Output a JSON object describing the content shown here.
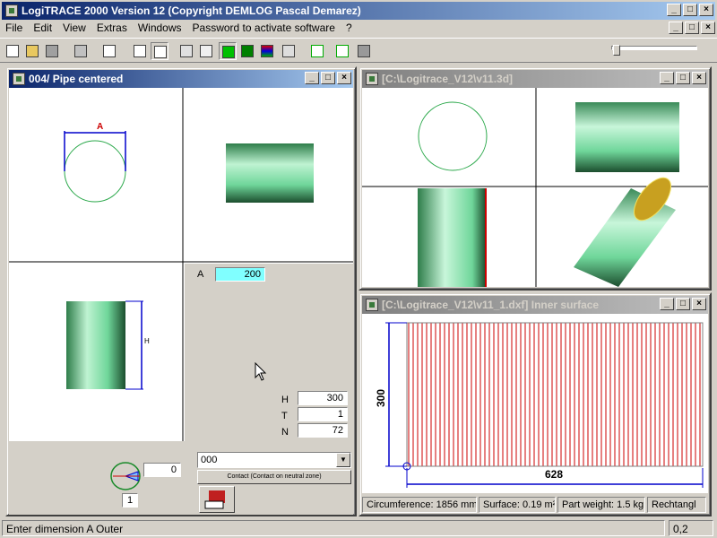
{
  "app": {
    "title": "LogiTRACE 2000  Version 12  (Copyright DEMLOG Pascal Demarez)"
  },
  "menu": [
    "File",
    "Edit",
    "View",
    "Extras",
    "Windows",
    "Password to activate software",
    "?"
  ],
  "win_main": {
    "title": "004/ Pipe centered"
  },
  "win_3d": {
    "title": "[C:\\Logitrace_V12\\v11.3d]"
  },
  "win_dxf": {
    "title": "[C:\\Logitrace_V12\\v11_1.dxf]  Inner surface"
  },
  "dims": {
    "a_label": "A",
    "a_value": "200",
    "h_label": "H",
    "h_value": "300",
    "t_label": "T",
    "t_value": "1",
    "n_label": "N",
    "n_value": "72",
    "drawing_a": "A",
    "drawing_h": "H"
  },
  "contact": {
    "select_value": "000",
    "button_label": "Contact (Contact on neutral zone)"
  },
  "angle": {
    "value": "0",
    "count": "1"
  },
  "dxf": {
    "height_label": "300",
    "width_label": "628",
    "circumference": "Circumference: 1856 mm",
    "surface": "Surface: 0.19 m²",
    "weight": "Part weight: 1.5 kg",
    "shape": "Rechtangl"
  },
  "status": {
    "message": "Enter dimension A Outer",
    "value": "0,2"
  },
  "colors": {
    "accent_title": "#0a246a",
    "pipe_green": "#6fd69a",
    "measure_blue": "#0000cc",
    "line_red": "#cc0000"
  }
}
